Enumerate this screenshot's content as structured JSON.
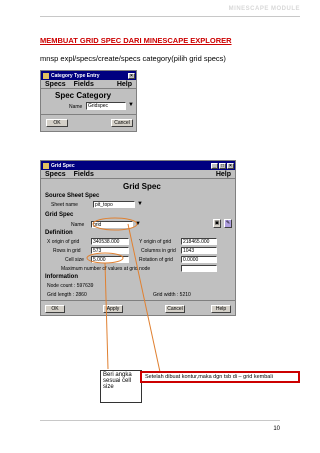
{
  "header": {
    "title": "MINESCAPE MODULE"
  },
  "heading": "MEMBUAT GRID SPEC DARI MINESCAPE EXPLORER",
  "command": "mnsp expl/specs/create/specs category(pilih grid specs)",
  "window1": {
    "title": "Category Type Entry",
    "menu": [
      "Specs",
      "Fields"
    ],
    "help": "Help",
    "heading": "Spec Category",
    "name_label": "Name",
    "name_value": "Gridspec",
    "ok": "OK",
    "cancel": "Cancel"
  },
  "window2": {
    "title": "Grid Spec",
    "menu": [
      "Specs",
      "Fields"
    ],
    "help": "Help",
    "heading": "Grid Spec",
    "source_sheet_spec": "Source Sheet Spec",
    "sheet_name_label": "Sheet name",
    "sheet_name_value": "pit_topo",
    "grid_spec_section": "Grid Spec",
    "name_label": "Name",
    "name_value": "grid",
    "definition": "Definition",
    "x_origin_label": "X origin of grid",
    "x_origin_value": "340538.000",
    "y_origin_label": "Y origin of grid",
    "y_origin_value": "218465.000",
    "rows_label": "Rows in grid",
    "rows_value": "573",
    "columns_label": "Columns in grid",
    "columns_value": "1043",
    "cell_size_label": "Cell size",
    "cell_size_value": "5.000",
    "rotation_label": "Rotation of grid",
    "rotation_value": "0.0000",
    "max_values_label": "Maximum number of values at grid node",
    "information": "Information",
    "node_count": "Node count : 597639",
    "grid_length": "Grid length : 2860",
    "grid_width": "Grid width : 5210",
    "ok": "OK",
    "apply": "Apply",
    "cancel": "Cancel",
    "help_button": "Help"
  },
  "callouts": {
    "cell": "Beri angka sesuai cell size",
    "kembali": "Setelah dibuat kontur,maka dgn tsb di – grid kembali"
  },
  "footer": {
    "page_number": "10"
  },
  "colors": {
    "heading": "#cc0000",
    "titlebar": "#000080",
    "window_bg": "#c0c0c0",
    "callout_border": "#cc0000"
  }
}
